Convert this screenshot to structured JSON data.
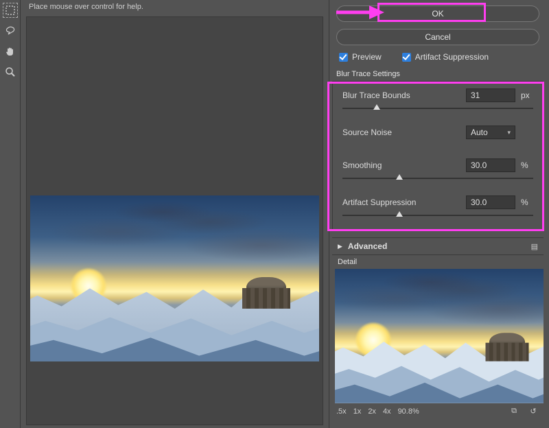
{
  "hint": "Place mouse over control for help.",
  "buttons": {
    "ok": "OK",
    "cancel": "Cancel"
  },
  "checkboxes": {
    "preview": "Preview",
    "artifact": "Artifact Suppression"
  },
  "group": {
    "title": "Blur Trace Settings",
    "bounds": {
      "label": "Blur Trace Bounds",
      "value": "31",
      "unit": "px",
      "pos": 18
    },
    "noise": {
      "label": "Source Noise",
      "value": "Auto"
    },
    "smooth": {
      "label": "Smoothing",
      "value": "30.0",
      "unit": "%",
      "pos": 30
    },
    "arti": {
      "label": "Artifact Suppression",
      "value": "30.0",
      "unit": "%",
      "pos": 30
    }
  },
  "advanced": {
    "label": "Advanced"
  },
  "detail": {
    "label": "Detail"
  },
  "zoom": {
    "steps": [
      ".5x",
      "1x",
      "2x",
      "4x"
    ],
    "pct": "90.8%"
  }
}
